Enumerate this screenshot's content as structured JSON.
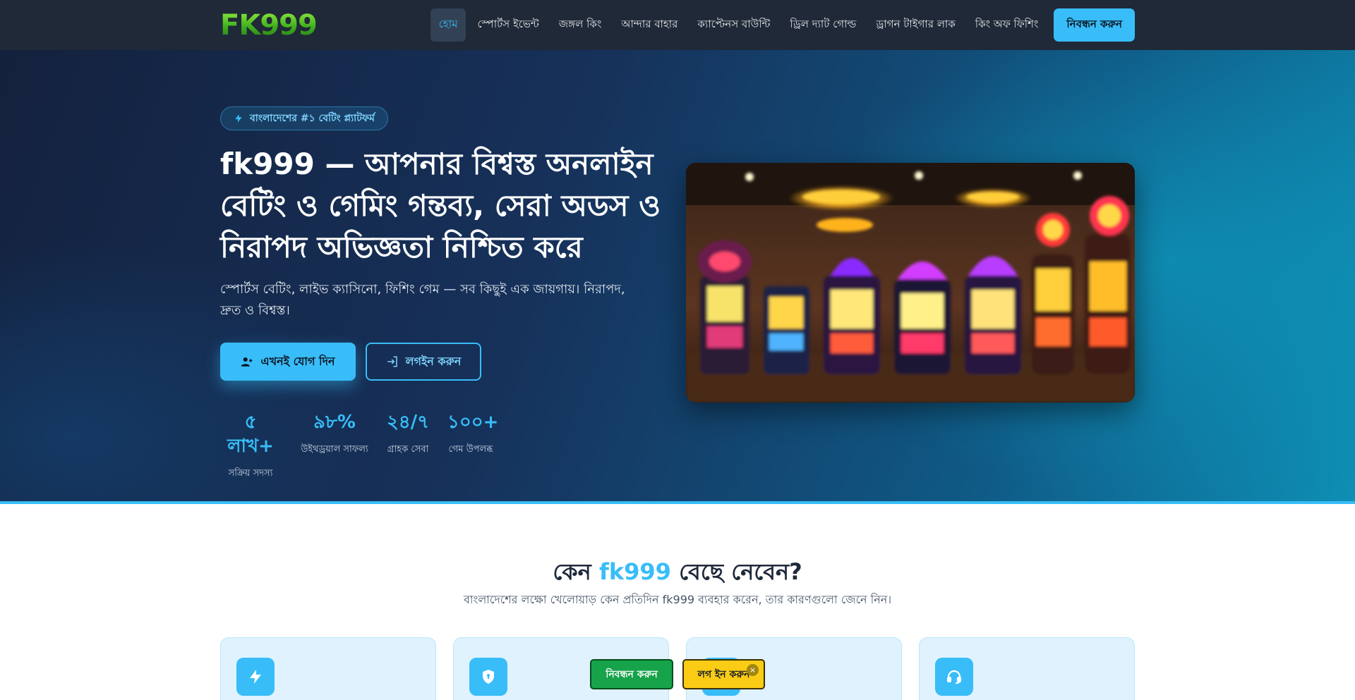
{
  "nav": {
    "logo": "FK999",
    "links": [
      "হোম",
      "স্পোর্টস ইভেন্ট",
      "জঙ্গল কিং",
      "আন্দার বাহার",
      "ক্যাপ্টেনস বাউন্টি",
      "ড্রিল দ্যাট গোল্ড",
      "ড্রাগন টাইগার লাক",
      "কিং অফ ফিশিং"
    ],
    "active_link": "হোম",
    "cta": "নিবন্ধন করুন"
  },
  "hero": {
    "badge": "বাংলাদেশের #১ বেটিং প্ল্যাটফর্ম",
    "badge_icon": "bolt-icon",
    "title": "fk999 — আপনার বিশ্বস্ত অনলাইন বেটিং ও গেমিং গন্তব্য, সেরা অডস ও নিরাপদ অভিজ্ঞতা নিশ্চিত করে",
    "subtitle": "স্পোর্টস বেটিং, লাইভ ক্যাসিনো, ফিশিং গেম — সব কিছুই এক জায়গায়। নিরাপদ, দ্রুত ও বিশ্বস্ত।",
    "join_button": "এখনই যোগ দিন",
    "join_icon": "user-plus-icon",
    "login_button": "লগইন করুন",
    "login_icon": "login-icon",
    "stats": [
      {
        "value": "৫ লাখ+",
        "label": "সক্রিয় সদস্য"
      },
      {
        "value": "৯৮%",
        "label": "উইথড্রয়াল সাফল্য"
      },
      {
        "value": "২৪/৭",
        "label": "গ্রাহক সেবা"
      },
      {
        "value": "১০০+",
        "label": "গেম উপলব্ধ"
      }
    ],
    "image_subject": "casino slot machines"
  },
  "features": {
    "title_prefix": "কেন",
    "title_accent": "fk999",
    "title_suffix": "বেছে নেবেন?",
    "subtitle": "বাংলাদেশের লক্ষো খেলোয়াড় কেন প্রতিদিন fk999 ব্যবহার করেন, তার কারণগুলো জেনে নিন।",
    "card_icons": [
      "bolt-icon",
      "shield-icon",
      "card-icon",
      "headset-icon"
    ]
  },
  "floating": {
    "register": "নিবন্ধন করুন",
    "login": "লগ ইন করুন",
    "close": "×"
  },
  "colors": {
    "accent": "#38bdf8",
    "nav_bg": "#1f2937",
    "register_green": "#16a34a",
    "login_yellow": "#facc15"
  }
}
